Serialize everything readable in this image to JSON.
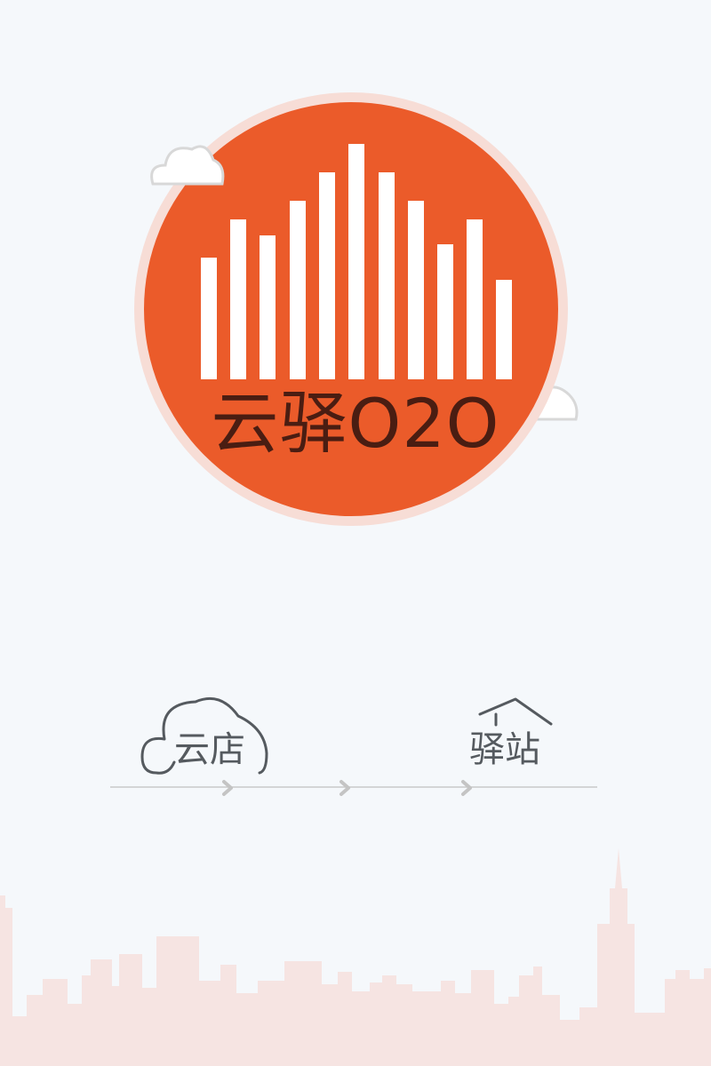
{
  "splash": {
    "logo_text": "云驿O2O",
    "brand_color": "#eb5b2a",
    "logo_text_color": "#4a1d12"
  },
  "flow": {
    "cloud_store_label": "云店",
    "station_label": "驿站",
    "icons": [
      "cloud-icon",
      "chevron-right-icon",
      "house-roof-icon"
    ]
  },
  "decor": {
    "skyline_color": "#f6e4e2",
    "cloud_colors": [
      "#ffffff",
      "#d9d9d9"
    ]
  }
}
